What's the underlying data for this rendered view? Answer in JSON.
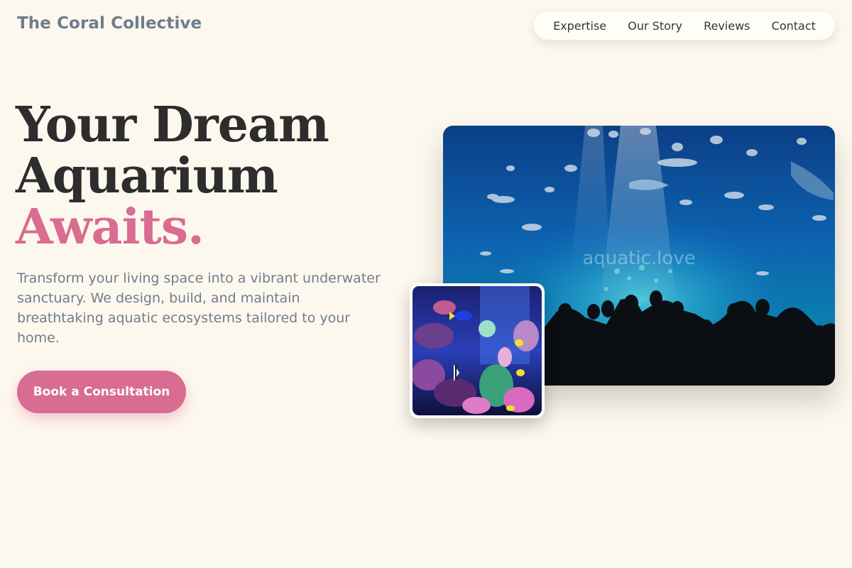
{
  "header": {
    "brand": "The Coral Collective",
    "nav": [
      "Expertise",
      "Our Story",
      "Reviews",
      "Contact"
    ]
  },
  "hero": {
    "title_line1": "Your Dream",
    "title_line2": "Aquarium",
    "title_accent": "Awaits.",
    "description": "Transform your living space into a vibrant underwater sanctuary. We design, build, and maintain breathtaking aquatic ecosystems tailored to your home.",
    "cta_label": "Book a Consultation"
  },
  "images": {
    "main_watermark": "aquatic.love",
    "main_alt": "Large public aquarium with visitors silhouetted in front of blue water",
    "inset_alt": "Coral reef aquarium with colorful fish"
  },
  "colors": {
    "background": "#fdf8ee",
    "accent": "#d96c91",
    "heading": "#2d2d2d",
    "muted_text": "#6f7d8c"
  }
}
